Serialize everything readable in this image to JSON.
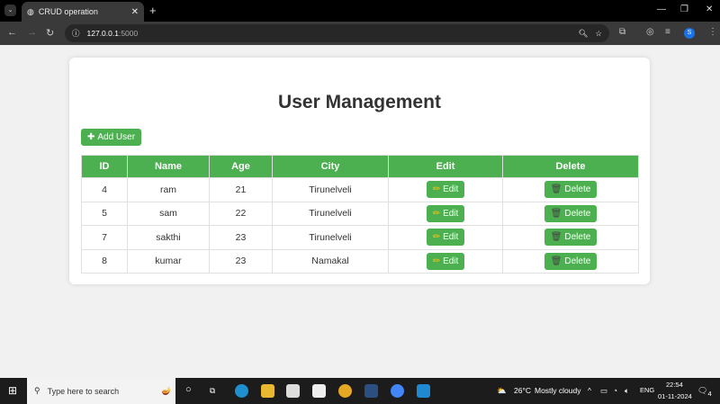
{
  "browser": {
    "tab_title": "CRUD operation",
    "url_host": "127.0.0.1",
    "url_port": ":5000"
  },
  "page": {
    "title": "User Management",
    "add_label": "Add User",
    "edit_label": "Edit",
    "delete_label": "Delete",
    "columns": [
      "ID",
      "Name",
      "Age",
      "City",
      "Edit",
      "Delete"
    ],
    "rows": [
      {
        "id": "4",
        "name": "ram",
        "age": "21",
        "city": "Tirunelveli"
      },
      {
        "id": "5",
        "name": "sam",
        "age": "22",
        "city": "Tirunelveli"
      },
      {
        "id": "7",
        "name": "sakthi",
        "age": "23",
        "city": "Tirunelveli"
      },
      {
        "id": "8",
        "name": "kumar",
        "age": "23",
        "city": "Namakal"
      }
    ]
  },
  "taskbar": {
    "search_placeholder": "Type here to search",
    "weather_temp": "26°C",
    "weather_text": "Mostly cloudy",
    "lang": "ENG",
    "time": "22:54",
    "date": "01-11-2024",
    "notif_count": "4"
  },
  "colors": {
    "accent": "#4caf50"
  }
}
